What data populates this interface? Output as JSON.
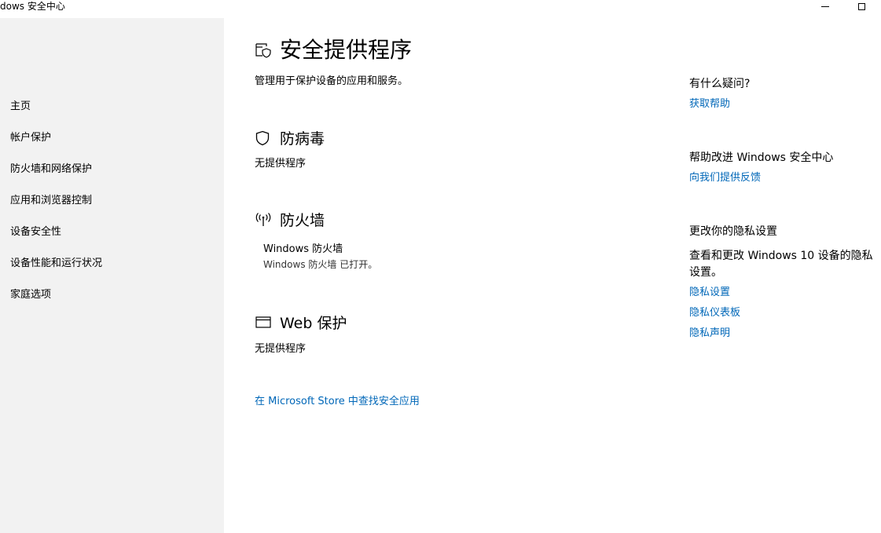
{
  "window": {
    "title": "dows 安全中心",
    "minimize_icon": "minimize-icon",
    "maximize_icon": "maximize-icon"
  },
  "sidebar": {
    "items": [
      {
        "label": "主页"
      },
      {
        "label": "帐户保护"
      },
      {
        "label": "防火墙和网络保护"
      },
      {
        "label": "应用和浏览器控制"
      },
      {
        "label": "设备安全性"
      },
      {
        "label": "设备性能和运行状况"
      },
      {
        "label": "家庭选项"
      }
    ]
  },
  "main": {
    "title": "安全提供程序",
    "title_icon": "security-providers-icon",
    "description": "管理用于保护设备的应用和服务。",
    "antivirus": {
      "title": "防病毒",
      "icon": "shield-icon",
      "status": "无提供程序"
    },
    "firewall": {
      "title": "防火墙",
      "icon": "antenna-icon",
      "provider_name": "Windows 防火墙",
      "provider_status": "Windows 防火墙 已打开。"
    },
    "web": {
      "title": "Web 保护",
      "icon": "browser-window-icon",
      "status": "无提供程序"
    },
    "store_link": "在 Microsoft Store 中查找安全应用"
  },
  "right_panel": {
    "questions": {
      "heading": "有什么疑问?",
      "link": "获取帮助"
    },
    "improve": {
      "heading": "帮助改进 Windows 安全中心",
      "link": "向我们提供反馈"
    },
    "privacy": {
      "heading": "更改你的隐私设置",
      "text": "查看和更改 Windows 10 设备的隐私设置。",
      "links": [
        "隐私设置",
        "隐私仪表板",
        "隐私声明"
      ]
    }
  },
  "colors": {
    "link": "#0067b8",
    "sidebar_bg": "#f2f2f2"
  }
}
